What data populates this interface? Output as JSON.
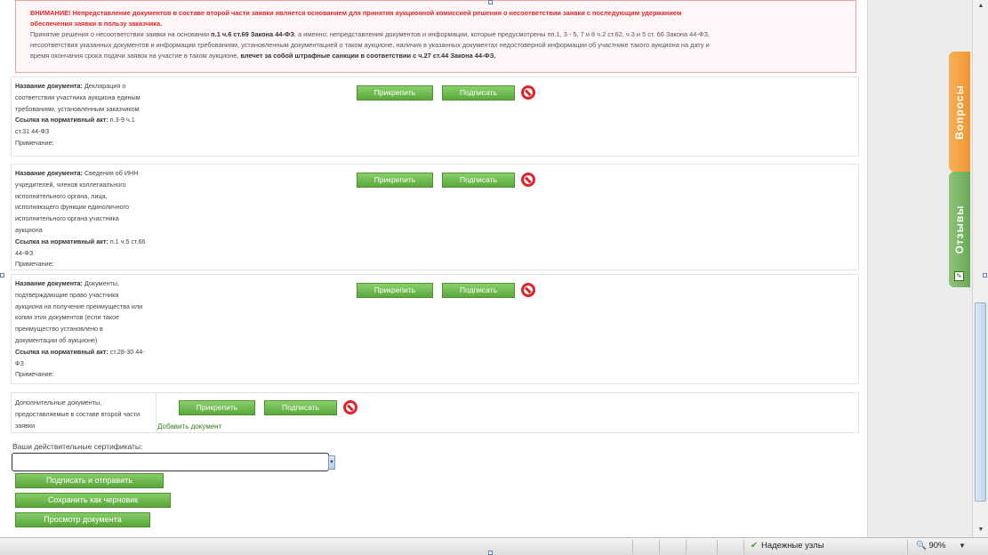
{
  "warning": {
    "line1_red": "ВНИМАНИЕ! Непредставление документов в составе второй части заявки является основанием для принятия аукционной комиссией решения о несоответствии заявки с последующим удержанием",
    "line2_red": "обеспечения заявки в пользу заказчика.",
    "line3_a": "Принятие решения о несоответствии заявки на основании ",
    "line3_bold": "п.1 ч.6 ст.69 Закона 44-ФЗ",
    "line3_b": ", а именно: непредставления документов и информации, которые предусмотрены пп.1, 3 - 5, 7 и 8 ч.2 ст.62, ч.3 и 5 ст. 66 Закона 44-ФЗ,",
    "line4": "несоответствия указанных документов и информации требованиям, установленным документацией о таком аукционе, наличия в указанных документах недостоверной информации об участнике такого аукциона на дату и",
    "line5_a": "время окончания срока подачи заявок на участие в таком аукционе, ",
    "line5_bold": "влечет за собой штрафные санкции в соответствии с ч.27 ст.44 Закона 44-ФЗ."
  },
  "labels": {
    "doc_name": "Название документа:",
    "norm_ref": "Ссылка на нормативный акт:",
    "note": "Примечание:",
    "attach": "Прикрепить",
    "sign": "Подписать"
  },
  "documents": [
    {
      "name": "Декларация о соответствии участника аукциона единым требованиям, установленным заказчиком",
      "ref": "п.3-9 ч.1 ст.31 44-ФЗ"
    },
    {
      "name": "Сведения об ИНН учредителей, членов коллегиального исполнительного органа, лица, исполняющего функции единоличного исполнительного органа участника аукциона",
      "ref": "п.1 ч.5 ст.66 44-ФЗ"
    },
    {
      "name": "Документы, подтверждающие право участника аукциона на получение преимущества или копии этих документов (если такое преимущество установлено в документации об аукционе)",
      "ref": "ст.28-30 44-ФЗ"
    }
  ],
  "additional": {
    "text": "Дополнительные документы, предоставляемые в составе второй части заявки",
    "add_link": "Добавить документ"
  },
  "certs": {
    "label": "Ваши действительные сертификаты:",
    "value": ""
  },
  "actions": {
    "sign_send": "Подписать и отправить",
    "save_draft": "Сохранить как черновик",
    "preview": "Просмотр документа"
  },
  "side_tabs": {
    "questions": "Вопросы",
    "reviews": "Отзывы"
  },
  "statusbar": {
    "trusted": "Надежные узлы",
    "zoom": "90%"
  },
  "colors": {
    "accent_green": "#5aa83b",
    "warning_red": "#e0262b",
    "tab_orange": "#f0952a",
    "tab_green": "#6aa857"
  }
}
